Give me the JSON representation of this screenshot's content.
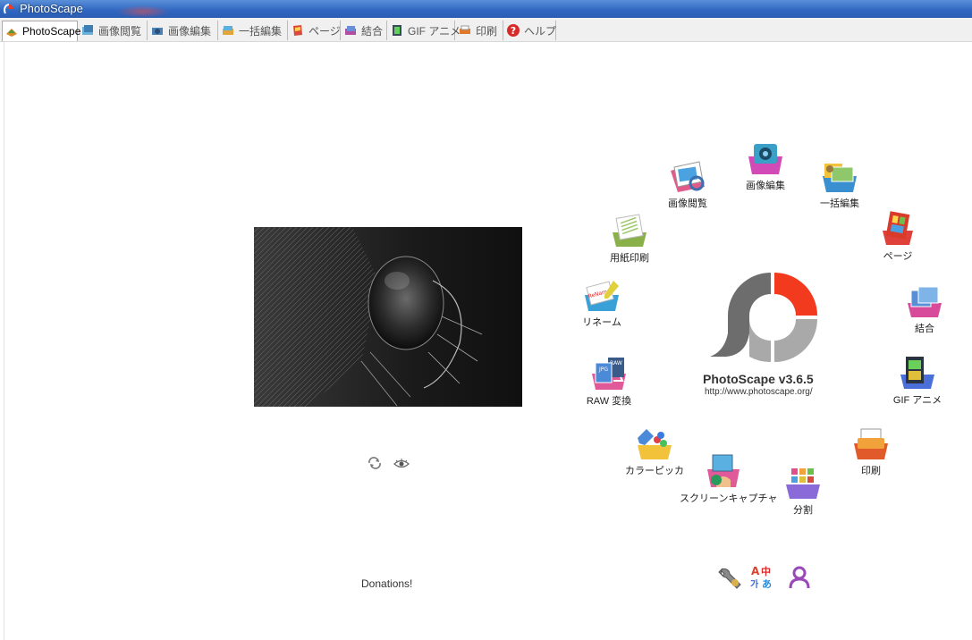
{
  "window": {
    "title": "PhotoScape"
  },
  "tabs": [
    {
      "label": "PhotoScape",
      "icon": "photoscape-icon",
      "active": true
    },
    {
      "label": "画像閲覧",
      "icon": "viewer-icon"
    },
    {
      "label": "画像編集",
      "icon": "editor-icon"
    },
    {
      "label": "一括編集",
      "icon": "batch-editor-icon"
    },
    {
      "label": "ページ",
      "icon": "page-icon"
    },
    {
      "label": "結合",
      "icon": "combine-icon"
    },
    {
      "label": "GIF アニメ",
      "icon": "gif-animation-icon"
    },
    {
      "label": "印刷",
      "icon": "print-icon"
    },
    {
      "label": "ヘルプ",
      "icon": "help-icon"
    }
  ],
  "home": {
    "donations_label": "Donations!",
    "logo_title": "PhotoScape v3.6.5",
    "logo_url": "http://www.photoscape.org/",
    "menu": [
      {
        "key": "viewer",
        "label": "画像閲覧"
      },
      {
        "key": "editor",
        "label": "画像編集"
      },
      {
        "key": "batch",
        "label": "一括編集"
      },
      {
        "key": "page",
        "label": "ページ"
      },
      {
        "key": "combine",
        "label": "結合"
      },
      {
        "key": "gif",
        "label": "GIF アニメ"
      },
      {
        "key": "print",
        "label": "印刷"
      },
      {
        "key": "splitter",
        "label": "分割"
      },
      {
        "key": "screen_capture",
        "label": "スクリーンキャプチャ"
      },
      {
        "key": "color_picker",
        "label": "カラーピッカ"
      },
      {
        "key": "raw",
        "label": "RAW 変換"
      },
      {
        "key": "rename",
        "label": "リネーム"
      },
      {
        "key": "paper_print",
        "label": "用紙印刷"
      }
    ]
  },
  "colors": {
    "titlebar": "#2f66c0",
    "logo_red": "#f23a1f",
    "logo_gray": "#6d6d6d",
    "logo_light_gray": "#a9a9a9"
  }
}
